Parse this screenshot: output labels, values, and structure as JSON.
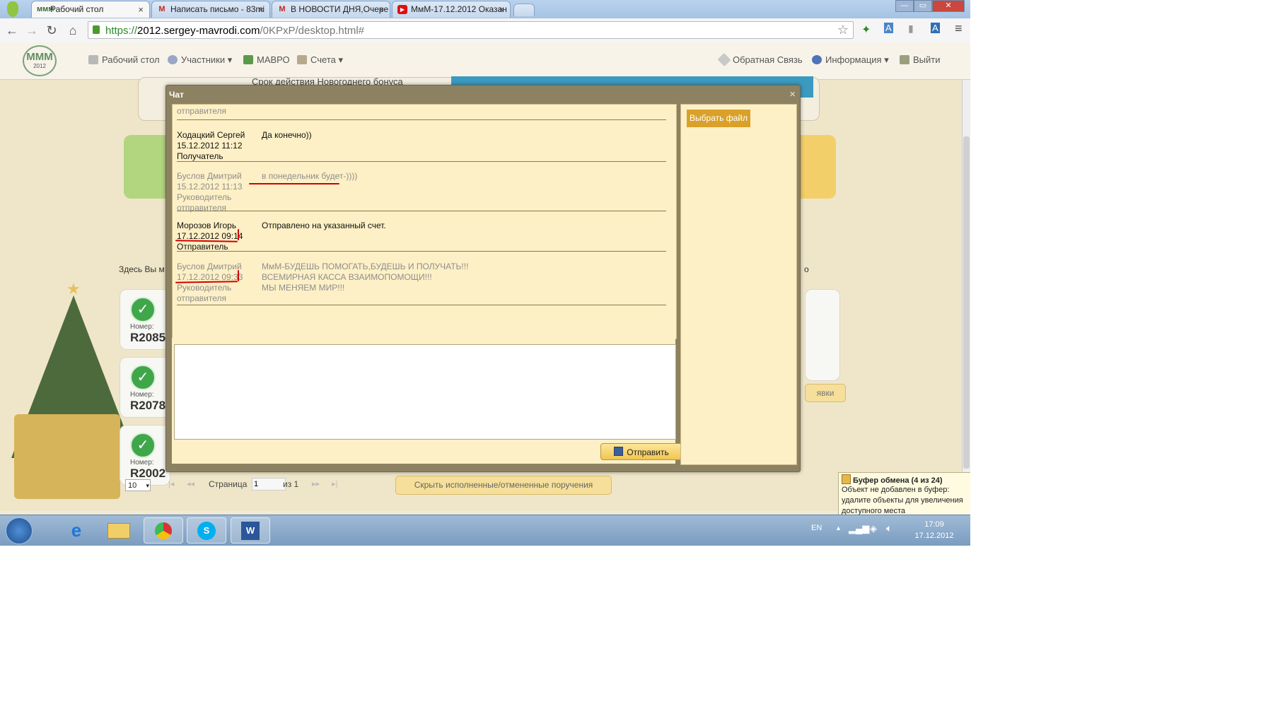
{
  "browser": {
    "tabs": [
      {
        "title": "Рабочий стол",
        "active": true,
        "icon": "mmm-favicon"
      },
      {
        "title": "Написать письмо - 83mi",
        "active": false,
        "icon": "gmail-icon"
      },
      {
        "title": "В НОВОСТИ ДНЯ,Очере",
        "active": false,
        "icon": "gmail-icon"
      },
      {
        "title": "МмМ-17.12.2012 Оказан",
        "active": false,
        "icon": "youtube-icon"
      }
    ],
    "close_symbol": "×",
    "url_scheme": "https://",
    "url_host": "2012.sergey-mavrodi.com",
    "url_path": "/0KPxP/desktop.html#"
  },
  "site": {
    "logo_text": "МММ",
    "logo_year": "2012",
    "menu": [
      {
        "label": "Рабочий стол",
        "icon": "desktop-icon"
      },
      {
        "label": "Участники",
        "icon": "users-icon",
        "dropdown": true
      },
      {
        "label": "МАВРО",
        "icon": "mavro-icon"
      },
      {
        "label": "Счета",
        "icon": "accounts-icon",
        "dropdown": true
      }
    ],
    "menu_right": [
      {
        "label": "Обратная Связь",
        "icon": "feedback-icon"
      },
      {
        "label": "Информация",
        "icon": "info-icon",
        "dropdown": true
      },
      {
        "label": "Выйти",
        "icon": "exit-icon"
      }
    ],
    "banner_text": "Срок действия Новогоднего бонуса",
    "intro_text": "Здесь Вы м",
    "intro_suffix": "о",
    "deals": [
      {
        "label": "Номер:",
        "number": "R2085"
      },
      {
        "label": "Номер:",
        "number": "R2078"
      },
      {
        "label": "Номер:",
        "number": "R2002"
      }
    ],
    "apps_button_fragment": "явки",
    "pagination": {
      "per_page": "10",
      "page_label": "Страница",
      "page_value": "1",
      "of_label": "из 1"
    },
    "hide_button": "Скрыть исполненные/отмененные поручения"
  },
  "chat": {
    "title": "Чат",
    "close": "×",
    "top_cut_label": "отправителя",
    "messages": [
      {
        "name": "Ходацкий Сергей",
        "date": "15.12.2012 11:12",
        "role": "Получатель",
        "text": "Да конечно))",
        "style": "dark"
      },
      {
        "name": "Буслов Дмитрий",
        "date": "15.12.2012 11:13",
        "role": "Руководитель\nотправителя",
        "text": "в понедельник будет-))))",
        "style": "gray"
      },
      {
        "name": "Морозов Игорь",
        "date": "17.12.2012 09:14",
        "role": "Отправитель",
        "text": "Отправлено на указанный счет.",
        "style": "dark"
      },
      {
        "name": "Буслов Дмитрий",
        "date": "17.12.2012 09:33",
        "role": "Руководитель\nотправителя",
        "text": "МмМ-БУДЕШЬ ПОМОГАТЬ,БУДЕШЬ И ПОЛУЧАТЬ!!!\nВСЕМИРНАЯ КАССА ВЗАИМОПОМОЩИ!!!\nМЫ МЕНЯЕМ МИР!!!",
        "style": "gray"
      }
    ],
    "input_value": "",
    "send_button": "Отправить",
    "file_button": "Выбрать файл"
  },
  "clipboard": {
    "title": "Буфер обмена (4 из 24)",
    "body": "Объект не добавлен в буфер: удалите объекты для увеличения доступного места"
  },
  "taskbar": {
    "apps": [
      "ie-icon",
      "explorer-icon",
      "chrome-icon",
      "skype-icon",
      "word-icon"
    ],
    "lang": "EN",
    "time": "17:09",
    "date": "17.12.2012"
  }
}
